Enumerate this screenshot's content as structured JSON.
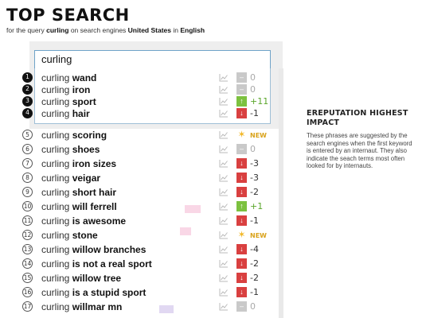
{
  "header": {
    "title": "TOP SEARCH",
    "subtitle_prefix": "for the query",
    "query": "curling",
    "subtitle_mid": "on search engines",
    "country": "United States",
    "subtitle_in": "in",
    "language": "English"
  },
  "search": {
    "value": "curling"
  },
  "results": [
    {
      "rank": "1",
      "prefix": "curling",
      "suffix": "wand",
      "trend": "flat",
      "change": "0"
    },
    {
      "rank": "2",
      "prefix": "curling",
      "suffix": "iron",
      "trend": "flat",
      "change": "0"
    },
    {
      "rank": "3",
      "prefix": "curling",
      "suffix": "sport",
      "trend": "up",
      "change": "+11"
    },
    {
      "rank": "4",
      "prefix": "curling",
      "suffix": "hair",
      "trend": "down",
      "change": "-1"
    },
    {
      "rank": "5",
      "prefix": "curling",
      "suffix": "scoring",
      "trend": "new",
      "change": "NEW"
    },
    {
      "rank": "6",
      "prefix": "curling",
      "suffix": "shoes",
      "trend": "flat",
      "change": "0"
    },
    {
      "rank": "7",
      "prefix": "curling",
      "suffix": "iron sizes",
      "trend": "down",
      "change": "-3"
    },
    {
      "rank": "8",
      "prefix": "curling",
      "suffix": "veigar",
      "trend": "down",
      "change": "-3"
    },
    {
      "rank": "9",
      "prefix": "curling",
      "suffix": "short hair",
      "trend": "down",
      "change": "-2"
    },
    {
      "rank": "10",
      "prefix": "curling",
      "suffix": "will ferrell",
      "trend": "up",
      "change": "+1"
    },
    {
      "rank": "11",
      "prefix": "curling",
      "suffix": "is awesome",
      "trend": "down",
      "change": "-1"
    },
    {
      "rank": "12",
      "prefix": "curling",
      "suffix": "stone",
      "trend": "new",
      "change": "NEW"
    },
    {
      "rank": "13",
      "prefix": "curling",
      "suffix": "willow branches",
      "trend": "down",
      "change": "-4"
    },
    {
      "rank": "14",
      "prefix": "curling",
      "suffix": "is not a real sport",
      "trend": "down",
      "change": "-2"
    },
    {
      "rank": "15",
      "prefix": "curling",
      "suffix": "willow tree",
      "trend": "down",
      "change": "-2"
    },
    {
      "rank": "16",
      "prefix": "curling",
      "suffix": "is a stupid sport",
      "trend": "down",
      "change": "-1"
    },
    {
      "rank": "17",
      "prefix": "curling",
      "suffix": "willmar mn",
      "trend": "flat",
      "change": "0"
    }
  ],
  "icons": {
    "chart": "chart-icon",
    "up": "arrow-up-icon",
    "down": "arrow-down-icon",
    "flat": "dash-icon",
    "new": "star-icon"
  },
  "colors": {
    "up": "#7cc13f",
    "down": "#d94040",
    "flat": "#c9c9c9",
    "new": "#f2b829",
    "accent": "#6fa3c8"
  },
  "sidebar": {
    "title": "EREPUTATION HIGHEST IMPACT",
    "text": "These phrases are suggested by the search engines when the first keyword is entered by an internaut. They also indicate the seach terms most often looked for by internauts."
  }
}
